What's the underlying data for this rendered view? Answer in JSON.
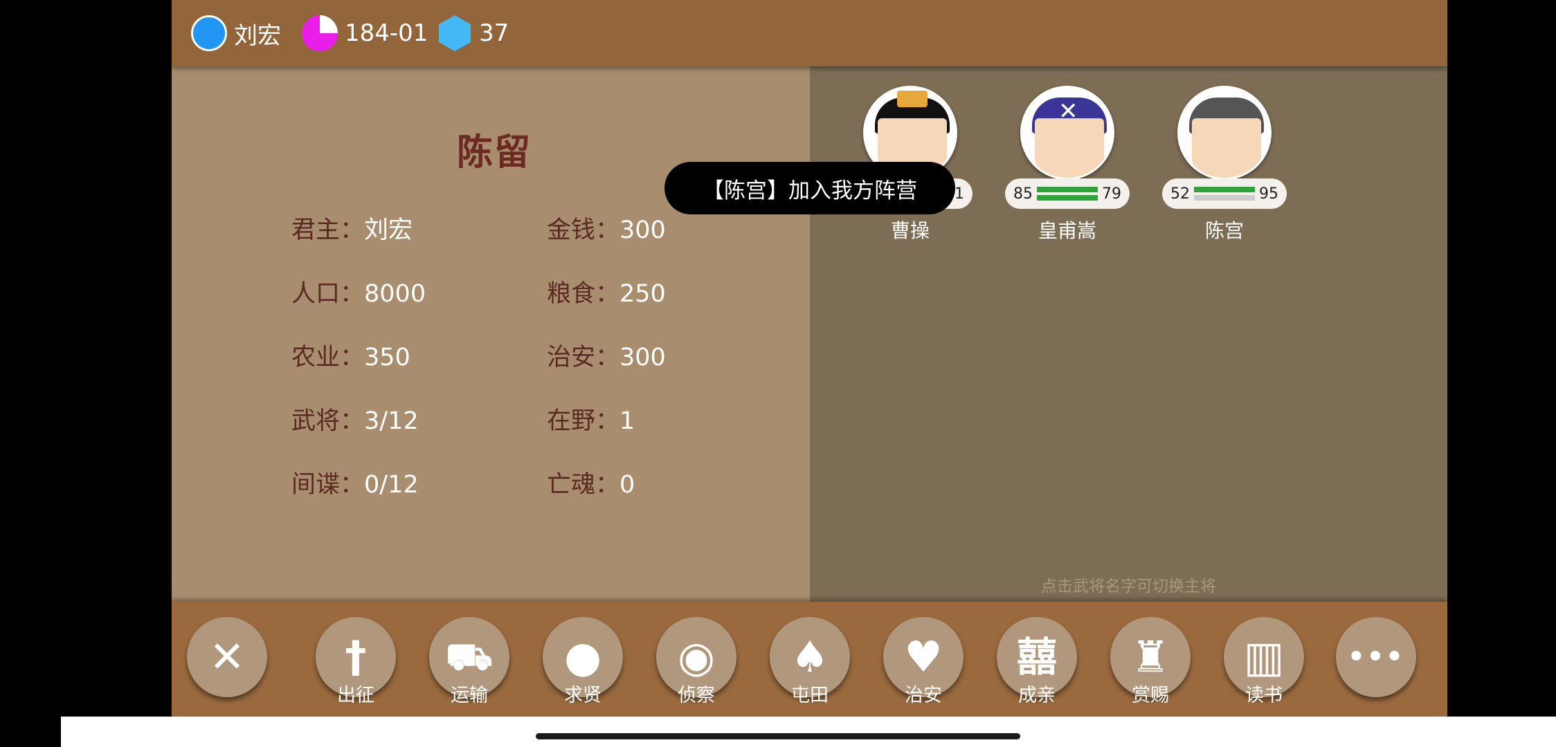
{
  "topbar": {
    "ruler_name": "刘宏",
    "date": "184-01",
    "gems": "37"
  },
  "city": {
    "name": "陈留",
    "stats": [
      {
        "label": "君主：",
        "value": "刘宏"
      },
      {
        "label": "金钱：",
        "value": "300"
      },
      {
        "label": "人口：",
        "value": "8000"
      },
      {
        "label": "粮食：",
        "value": "250"
      },
      {
        "label": "农业：",
        "value": "350"
      },
      {
        "label": "治安：",
        "value": "300"
      },
      {
        "label": "武将：",
        "value": "3/12"
      },
      {
        "label": "在野：",
        "value": "1"
      },
      {
        "label": "间谍：",
        "value": "0/12"
      },
      {
        "label": "亡魂：",
        "value": "0"
      }
    ]
  },
  "generals": [
    {
      "name": "曹操",
      "left_stat": "",
      "right_stat": "91",
      "bar_color_top": "#2ea33a",
      "bar_color_bottom": "#2ea33a"
    },
    {
      "name": "皇甫嵩",
      "left_stat": "85",
      "right_stat": "79",
      "bar_color_top": "#2ea33a",
      "bar_color_bottom": "#2ea33a"
    },
    {
      "name": "陈宫",
      "left_stat": "52",
      "right_stat": "95",
      "bar_color_top": "#2ea33a",
      "bar_color_bottom": "#cccccc"
    }
  ],
  "toast": "【陈宫】加入我方阵营",
  "hint": "点击武将名字可切换主将",
  "actions": [
    {
      "label": "",
      "icon": "close-icon",
      "glyph": "✕"
    },
    {
      "label": "出征",
      "icon": "sword-icon",
      "glyph": "†"
    },
    {
      "label": "运输",
      "icon": "cart-icon",
      "glyph": "⛟"
    },
    {
      "label": "求贤",
      "icon": "person-icon",
      "glyph": "●"
    },
    {
      "label": "侦察",
      "icon": "eye-icon",
      "glyph": "◉"
    },
    {
      "label": "屯田",
      "icon": "wheat-icon",
      "glyph": "♠"
    },
    {
      "label": "治安",
      "icon": "shield-icon",
      "glyph": "♥"
    },
    {
      "label": "成亲",
      "icon": "double-happiness-icon",
      "glyph": "囍"
    },
    {
      "label": "赏赐",
      "icon": "tower-icon",
      "glyph": "♜"
    },
    {
      "label": "读书",
      "icon": "book-icon",
      "glyph": "▥"
    },
    {
      "label": "",
      "icon": "more-icon",
      "glyph": "•••"
    }
  ],
  "colors": {
    "topbar": "#92653b",
    "left_panel": "#a88e6e",
    "right_panel": "#7d6d55",
    "title_red": "#6b2a22"
  }
}
